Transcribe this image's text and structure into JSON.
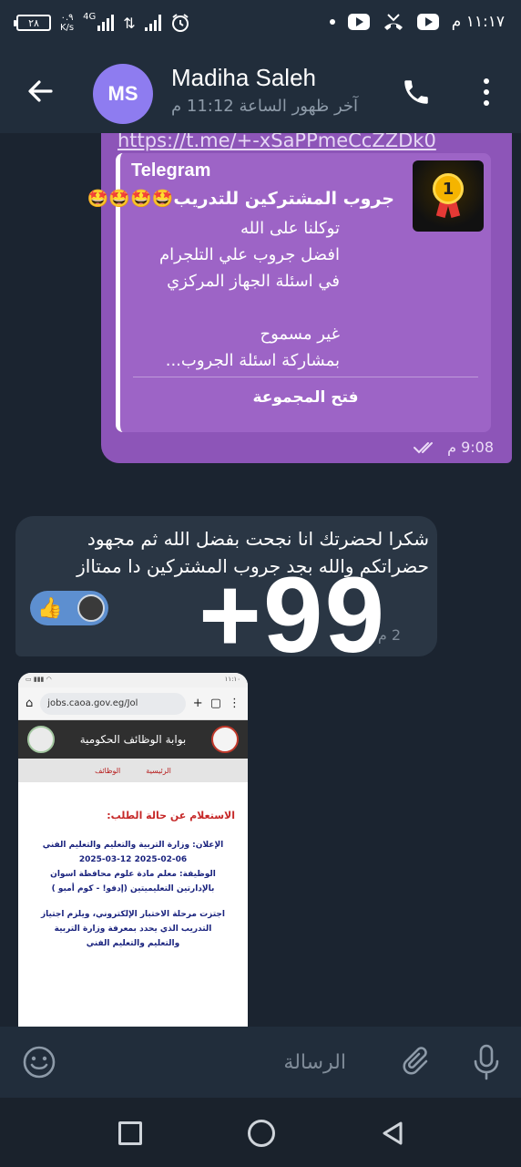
{
  "status_bar": {
    "battery": "٢٨",
    "net_speed_value": "٠.٩",
    "net_speed_unit": "K/s",
    "network_type": "4G",
    "time": "١١:١٧ م"
  },
  "header": {
    "avatar_initials": "MS",
    "contact_name": "Madiha Saleh",
    "last_seen": "آخر ظهور الساعة 11:12 م"
  },
  "messages": {
    "outgoing": {
      "link": "https://t.me/+-xSaPPmeCcZZDk0",
      "preview": {
        "site": "Telegram",
        "title": "جروب المشتركين للتدريب🤩🤩🤩🤩",
        "description": "توكلنا على الله\nافضل جروب علي التلجرام\nفي اسئلة الجهاز المركزي\n\nغير مسموح\nبمشاركة اسئلة  الجروب...",
        "thumb_badge": "1",
        "button": "فتح المجموعة"
      },
      "time": "9:08 م",
      "status_icon": "double-check-icon"
    },
    "incoming": {
      "text_line1": "شكرا لحضرتك انا نجحت بفضل الله ثم مجهود",
      "text_line2": "حضراتكم والله بجد جروب المشتركين دا ممتااز",
      "reaction_emoji": "👍",
      "time": "2 م"
    },
    "overlay_text": "+99",
    "photo": {
      "status_time": "١١:١٠",
      "url": "jobs.caoa.gov.eg/Jol",
      "site_title": "بوابة الوظائف الحكومية",
      "nav_home": "الرئيسية",
      "nav_jobs": "الوظائف",
      "heading": "الاستعلام عن حالة الطلب:",
      "line1": "الإعلان: وزارة التربية والتعليم والتعليم الفني",
      "line2": "2025-02-06 2025-03-12",
      "line3": "الوظيفة: معلم مادة علوم محافظة اسوان",
      "line4": "بالإدارتين التعليميتين (إدفو! - كوم أمبو )",
      "line5": "اجتزت مرحلة الاختبار الإلكتروني، ويلزم اجتياز",
      "line6": "التدريب الذي يحدد بمعرفة وزارة التربية",
      "line7": "والتعليم والتعليم الفني"
    }
  },
  "input_bar": {
    "placeholder": "الرسالة"
  },
  "colors": {
    "background": "#1b2430",
    "bar": "#212d3b",
    "outgoing_bubble": "#8d55b8",
    "incoming_bubble": "#2a3644",
    "avatar": "#8e7cf0"
  }
}
